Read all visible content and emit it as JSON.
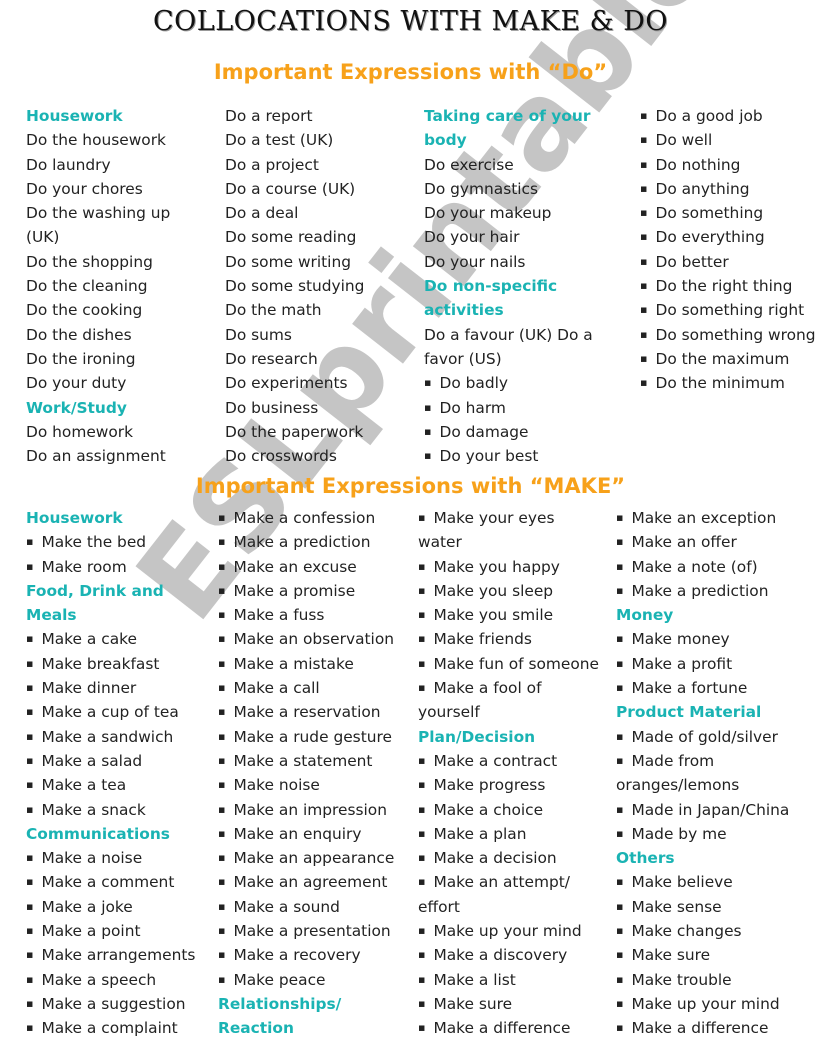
{
  "title": "COLLOCATIONS WITH MAKE & DO",
  "colors": {
    "heading": "#f7a11a",
    "category": "#1ab3b3",
    "text": "#222222",
    "watermark": "#969696"
  },
  "watermark": "ESLprintables.com",
  "do_section": {
    "heading": "Important Expressions with “Do”",
    "columns": [
      [
        {
          "t": "Housework",
          "k": "cat"
        },
        {
          "t": "Do the housework"
        },
        {
          "t": "Do laundry"
        },
        {
          "t": "Do your chores"
        },
        {
          "t": "Do the washing up"
        },
        {
          "t": "(UK)"
        },
        {
          "t": "Do the shopping"
        },
        {
          "t": "Do the cleaning"
        },
        {
          "t": "Do the cooking"
        },
        {
          "t": "Do the dishes"
        },
        {
          "t": "Do the ironing"
        },
        {
          "t": "Do your duty"
        },
        {
          "t": "Work/Study",
          "k": "cat"
        },
        {
          "t": "Do homework"
        },
        {
          "t": "Do an assignment"
        }
      ],
      [
        {
          "t": "Do a report"
        },
        {
          "t": "Do a test (UK)"
        },
        {
          "t": "Do a project"
        },
        {
          "t": "Do a course (UK)"
        },
        {
          "t": "Do a deal"
        },
        {
          "t": "Do some reading"
        },
        {
          "t": "Do some writing"
        },
        {
          "t": "Do some studying"
        },
        {
          "t": "Do the math"
        },
        {
          "t": "Do sums"
        },
        {
          "t": "Do research"
        },
        {
          "t": "Do experiments"
        },
        {
          "t": "Do business"
        },
        {
          "t": "Do the paperwork"
        },
        {
          "t": "Do crosswords"
        }
      ],
      [
        {
          "t": "Taking care of your",
          "k": "cat"
        },
        {
          "t": "body",
          "k": "cat"
        },
        {
          "t": "Do exercise"
        },
        {
          "t": "Do gymnastics"
        },
        {
          "t": "Do your makeup"
        },
        {
          "t": "Do your hair"
        },
        {
          "t": "Do your nails"
        },
        {
          "t": "Do non-specific",
          "k": "cat"
        },
        {
          "t": "activities",
          "k": "cat"
        },
        {
          "t": "Do a favour (UK) Do a"
        },
        {
          "t": "favor (US)"
        },
        {
          "t": "Do badly",
          "k": "bul"
        },
        {
          "t": "Do harm",
          "k": "bul"
        },
        {
          "t": "Do damage",
          "k": "bul"
        },
        {
          "t": "Do your best",
          "k": "bul"
        }
      ],
      [
        {
          "t": "Do a good job",
          "k": "bul"
        },
        {
          "t": "Do well",
          "k": "bul"
        },
        {
          "t": "Do nothing",
          "k": "bul"
        },
        {
          "t": "Do anything",
          "k": "bul"
        },
        {
          "t": "Do something",
          "k": "bul"
        },
        {
          "t": "Do everything",
          "k": "bul"
        },
        {
          "t": "Do better",
          "k": "bul"
        },
        {
          "t": "Do the right thing",
          "k": "bul"
        },
        {
          "t": "Do something right",
          "k": "bul"
        },
        {
          "t": "Do something wrong",
          "k": "bul"
        },
        {
          "t": "Do the maximum",
          "k": "bul"
        },
        {
          "t": "Do the minimum",
          "k": "bul"
        }
      ]
    ]
  },
  "make_section": {
    "heading": "Important Expressions with “MAKE”",
    "columns": [
      [
        {
          "t": "Housework",
          "k": "cat"
        },
        {
          "t": "Make the bed",
          "k": "bul"
        },
        {
          "t": "Make room",
          "k": "bul"
        },
        {
          "t": "Food, Drink and",
          "k": "cat"
        },
        {
          "t": "Meals",
          "k": "cat"
        },
        {
          "t": "Make a cake",
          "k": "bul"
        },
        {
          "t": "Make breakfast",
          "k": "bul"
        },
        {
          "t": "Make dinner",
          "k": "bul"
        },
        {
          "t": "Make a cup of tea",
          "k": "bul"
        },
        {
          "t": "Make a sandwich",
          "k": "bul"
        },
        {
          "t": "Make a salad",
          "k": "bul"
        },
        {
          "t": "Make a tea",
          "k": "bul"
        },
        {
          "t": "Make a snack",
          "k": "bul"
        },
        {
          "t": "Communications",
          "k": "cat"
        },
        {
          "t": "Make a noise",
          "k": "bul"
        },
        {
          "t": "Make a comment",
          "k": "bul"
        },
        {
          "t": "Make a joke",
          "k": "bul"
        },
        {
          "t": "Make a point",
          "k": "bul"
        },
        {
          "t": "Make arrangements",
          "k": "bul"
        },
        {
          "t": "Make a speech",
          "k": "bul"
        },
        {
          "t": "Make a suggestion",
          "k": "bul"
        },
        {
          "t": "Make a complaint",
          "k": "bul"
        }
      ],
      [
        {
          "t": "Make a confession",
          "k": "bul"
        },
        {
          "t": "Make a prediction",
          "k": "bul"
        },
        {
          "t": "Make an excuse",
          "k": "bul"
        },
        {
          "t": "Make a promise",
          "k": "bul"
        },
        {
          "t": "Make a fuss",
          "k": "bul"
        },
        {
          "t": "Make an observation",
          "k": "bul"
        },
        {
          "t": "Make a mistake",
          "k": "bul"
        },
        {
          "t": "Make a call",
          "k": "bul"
        },
        {
          "t": "Make a reservation",
          "k": "bul"
        },
        {
          "t": "Make a rude gesture",
          "k": "bul"
        },
        {
          "t": "Make a statement",
          "k": "bul"
        },
        {
          "t": "Make noise",
          "k": "bul"
        },
        {
          "t": "Make an impression",
          "k": "bul"
        },
        {
          "t": "Make an enquiry",
          "k": "bul"
        },
        {
          "t": "Make an appearance",
          "k": "bul"
        },
        {
          "t": "Make an agreement",
          "k": "bul"
        },
        {
          "t": "Make a sound",
          "k": "bul"
        },
        {
          "t": "Make a presentation",
          "k": "bul"
        },
        {
          "t": "Make a recovery",
          "k": "bul"
        },
        {
          "t": "Make peace",
          "k": "bul"
        },
        {
          "t": "Relationships/",
          "k": "cat"
        },
        {
          "t": "Reaction",
          "k": "cat"
        }
      ],
      [
        {
          "t": "Make your eyes",
          "k": "bul"
        },
        {
          "t": "water"
        },
        {
          "t": "Make you happy",
          "k": "bul"
        },
        {
          "t": "Make you sleep",
          "k": "bul"
        },
        {
          "t": "Make you smile",
          "k": "bul"
        },
        {
          "t": "Make friends",
          "k": "bul"
        },
        {
          "t": "Make fun of someone",
          "k": "bul"
        },
        {
          "t": "Make a fool of",
          "k": "bul"
        },
        {
          "t": "yourself"
        },
        {
          "t": "Plan/Decision",
          "k": "cat"
        },
        {
          "t": "Make a contract",
          "k": "bul"
        },
        {
          "t": "Make progress",
          "k": "bul"
        },
        {
          "t": "Make a choice",
          "k": "bul"
        },
        {
          "t": "Make a plan",
          "k": "bul"
        },
        {
          "t": "Make a decision",
          "k": "bul"
        },
        {
          "t": "Make an attempt/",
          "k": "bul"
        },
        {
          "t": "effort"
        },
        {
          "t": "Make up your mind",
          "k": "bul"
        },
        {
          "t": "Make a discovery",
          "k": "bul"
        },
        {
          "t": "Make a list",
          "k": "bul"
        },
        {
          "t": "Make sure",
          "k": "bul"
        },
        {
          "t": "Make a difference",
          "k": "bul"
        }
      ],
      [
        {
          "t": "Make an exception",
          "k": "bul"
        },
        {
          "t": "Make an offer",
          "k": "bul"
        },
        {
          "t": "Make a note (of)",
          "k": "bul"
        },
        {
          "t": "Make a prediction",
          "k": "bul"
        },
        {
          "t": "Money",
          "k": "cat"
        },
        {
          "t": "Make money",
          "k": "bul"
        },
        {
          "t": "Make a profit",
          "k": "bul"
        },
        {
          "t": "Make a fortune",
          "k": "bul"
        },
        {
          "t": "Product Material",
          "k": "cat"
        },
        {
          "t": "Made of gold/silver",
          "k": "bul"
        },
        {
          "t": "Made from",
          "k": "bul"
        },
        {
          "t": "oranges/lemons"
        },
        {
          "t": "Made in Japan/China",
          "k": "bul"
        },
        {
          "t": "Made by me",
          "k": "bul"
        },
        {
          "t": "Others",
          "k": "cat"
        },
        {
          "t": "Make believe",
          "k": "bul"
        },
        {
          "t": "Make sense",
          "k": "bul"
        },
        {
          "t": "Make changes",
          "k": "bul"
        },
        {
          "t": "Make sure",
          "k": "bul"
        },
        {
          "t": "Make trouble",
          "k": "bul"
        },
        {
          "t": "Make up your mind",
          "k": "bul"
        },
        {
          "t": "Make a difference",
          "k": "bul"
        }
      ]
    ]
  }
}
